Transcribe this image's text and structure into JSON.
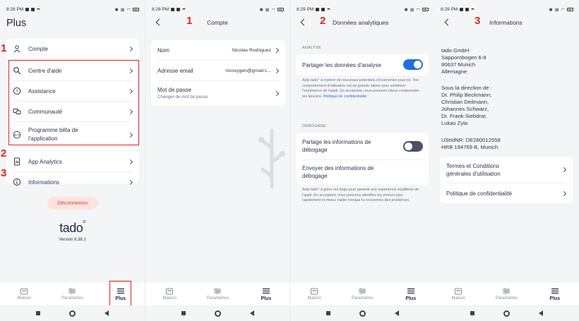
{
  "status": {
    "time_1": "8:28 PM",
    "time_2": "8:28 PM",
    "time_3": "8:29 PM",
    "time_4": "8:29 PM",
    "dots": "•••"
  },
  "annotations": {
    "m1_a": "1",
    "m2_a": "2",
    "m3_a": "3",
    "m1_b": "1",
    "m2_b": "2",
    "m3_b": "3"
  },
  "screen1": {
    "title": "Plus",
    "items": [
      {
        "label": "Compte",
        "icon": "person-icon"
      },
      {
        "label": "Centre d'aide",
        "icon": "search-icon"
      },
      {
        "label": "Assistance",
        "icon": "help-circle-icon"
      },
      {
        "label": "Communauté",
        "icon": "chat-icon"
      },
      {
        "label": "Programme bêta de l'application",
        "label_l1": "Programme bêta de",
        "label_l2": "l'application",
        "icon": "beta-icon"
      },
      {
        "label": "App Analytics",
        "icon": "phone-analytics-icon"
      },
      {
        "label": "Informations",
        "icon": "info-icon"
      }
    ],
    "logout": "Déconnexion",
    "logo": "tado",
    "version": "Version 8.38.1"
  },
  "tabs": {
    "home": "Maison",
    "settings": "Paramètres",
    "more": "Plus"
  },
  "screen2": {
    "title": "Compte",
    "rows": [
      {
        "label": "Nom",
        "value": "Nicolas Rodriguez"
      },
      {
        "label": "Adresse email",
        "value": "nicoxygen@gmail.c..."
      },
      {
        "label": "Mot de passe",
        "sub": "Changer de mot de passe"
      }
    ]
  },
  "screen3": {
    "title": "Données analytiques",
    "section1": "ANALYSE",
    "share_analytics": "Partager les données d'analyse",
    "share_analytics_on": true,
    "analytics_desc": "Aide tado° à repérer de nouveaux potentiels d'économies pour toi. Ton comportement d'utilisation est de grande valeur pour améliorer l'expérience de l'appli. En acceptant, nous pouvons mieux comprendre tes besoins.",
    "privacy_link": "Politique de confidentialité",
    "section2": "DÉBOGAGE",
    "share_debug_l1": "Partage les informations de",
    "share_debug_l2": "débogage",
    "share_debug_on": false,
    "send_debug_l1": "Envoyer des informations de",
    "send_debug_l2": "débogage",
    "debug_desc": "Aide tado° à gérer tes bugs pour garantir une expérience équilibrée de l'appli. En acceptant, nous pouvons identifier les erreurs plus rapidement et mieux t'aider lorsque tu rencontres des problèmes."
  },
  "screen4": {
    "title": "Informations",
    "address": [
      "tado GmbH",
      "Sapporobogen 6-8",
      "80637 Munich",
      "Allemagne"
    ],
    "direction": [
      "Sous la direction de :",
      "Dr. Philip Beckmann,",
      "Christian Deilmann,",
      "Johannes Schwarz,",
      "Dr. Frank Siebdrat,",
      "Lukas Zyla"
    ],
    "ids": [
      "UStIdNR: DE280012558",
      "HRB 194769 B, Munich"
    ],
    "links": [
      {
        "l1": "Termes et Conditions",
        "l2": "générales d'utilisation"
      },
      {
        "l1": "Politique de confidentialité"
      }
    ]
  }
}
